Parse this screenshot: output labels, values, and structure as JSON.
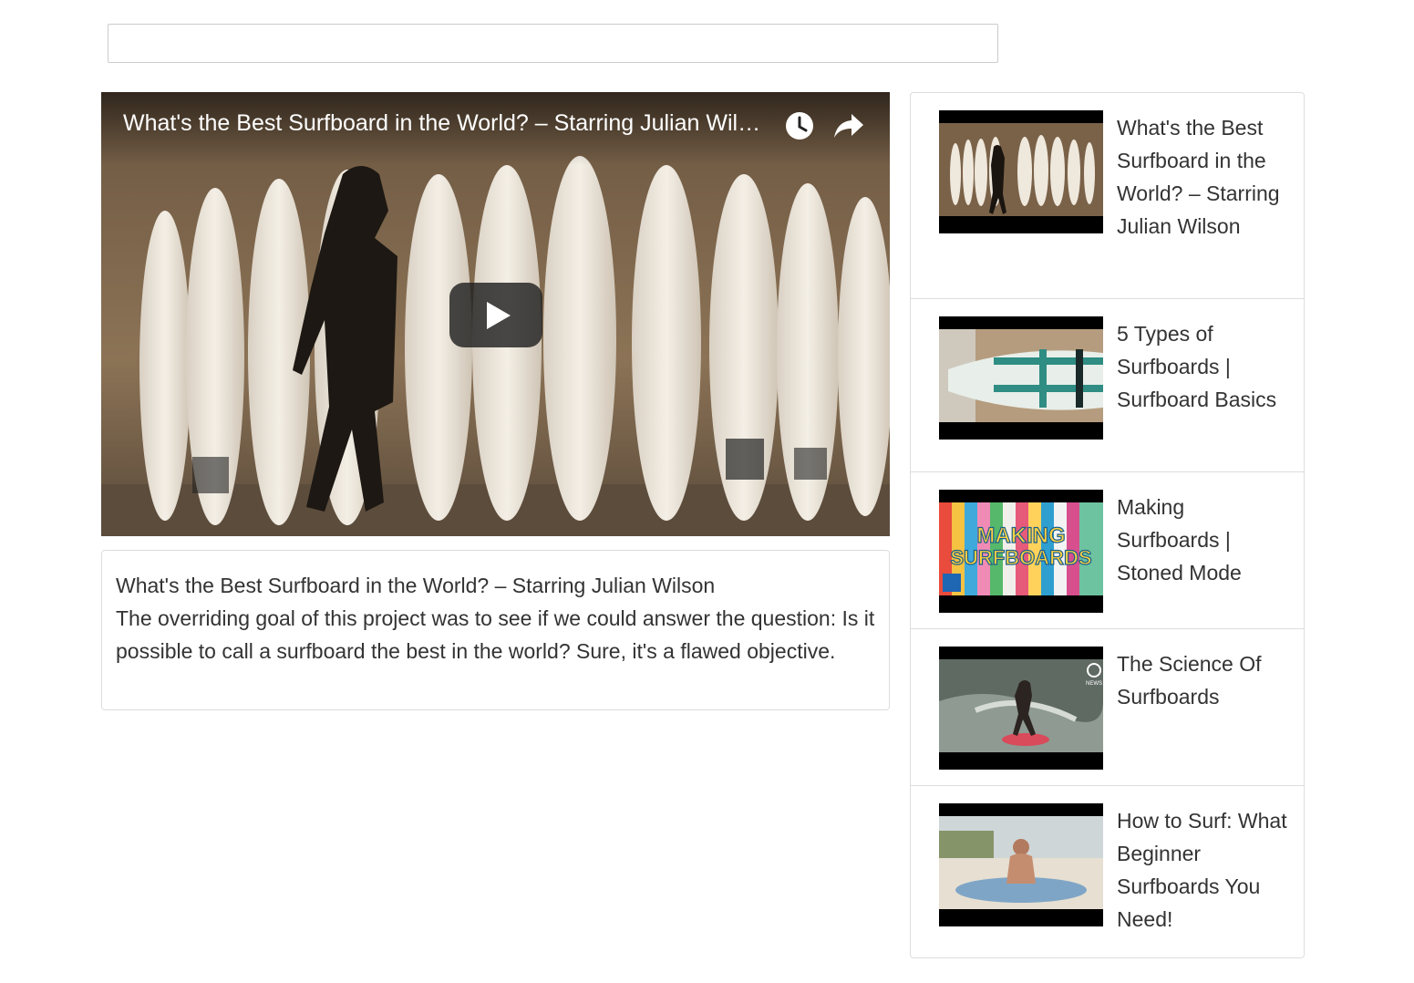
{
  "search": {
    "placeholder": "",
    "value": ""
  },
  "player": {
    "title": "What's the Best Surfboard in the World? – Starring Julian Wilson",
    "icons": {
      "watch_later": "clock-icon",
      "share": "share-arrow-icon",
      "play": "play-icon"
    }
  },
  "detail": {
    "title": "What's the Best Surfboard in the World? – Starring Julian Wilson",
    "description": "The overriding goal of this project was to see if we could answer the question: Is it possible to call a surfboard the best in the world? Sure, it's a flawed objective."
  },
  "thumb_labels": {
    "making": "MAKING",
    "surfboards": "SURFBOARDS",
    "news": "NEWS"
  },
  "videos": [
    {
      "title": "What's the Best Surfboard in the World? – Starring Julian Wilson"
    },
    {
      "title": "5 Types of Surfboards | Surfboard Basics"
    },
    {
      "title": "Making Surfboards | Stoned Mode"
    },
    {
      "title": "The Science Of Surfboards"
    },
    {
      "title": "How to Surf: What Beginner Surfboards You Need!"
    }
  ],
  "colors": {
    "border": "#dddddd",
    "text": "#333333"
  }
}
